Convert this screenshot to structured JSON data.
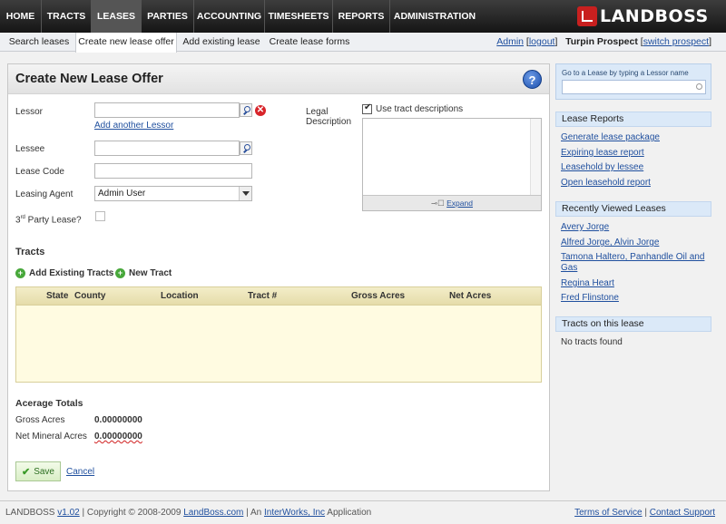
{
  "nav": {
    "items": [
      "HOME",
      "TRACTS",
      "LEASES",
      "PARTIES",
      "ACCOUNTING",
      "TIMESHEETS",
      "REPORTS",
      "ADMINISTRATION"
    ],
    "active_index": 2,
    "logo": "LANDBOSS"
  },
  "subnav": {
    "items": [
      "Search leases",
      "Create new lease offer",
      "Add existing lease",
      "Create lease forms"
    ],
    "active_index": 1,
    "user": "Admin",
    "logout": "logout",
    "project": "Turpin Prospect",
    "switch": "switch prospect"
  },
  "form": {
    "title": "Create New Lease Offer",
    "help": "?",
    "lessor_label": "Lessor",
    "lessor_value": "",
    "add_lessor": "Add another Lessor",
    "lessee_label": "Lessee",
    "lessee_value": "",
    "lease_code_label": "Lease Code",
    "lease_code_value": "",
    "agent_label": "Leasing Agent",
    "agent_value": "Admin User",
    "third_party_label": "3",
    "third_party_sup": "rd",
    "third_party_rest": " Party Lease?",
    "third_party_checked": false,
    "legal_label_1": "Legal",
    "legal_label_2": "Description",
    "use_tract_label": "Use tract descriptions",
    "use_tract_checked": true,
    "expand_label": "Expand",
    "expand_icon": "⊸☐",
    "tracts_title": "Tracts",
    "add_existing": "Add Existing Tracts",
    "new_tract": "New Tract",
    "table_headers": [
      "State",
      "County",
      "Location",
      "Tract #",
      "Gross Acres",
      "Net Acres"
    ],
    "totals_title": "Acerage Totals",
    "gross_label": "Gross Acres",
    "gross_value": "0.00000000",
    "net_label": "Net Mineral Acres",
    "net_value": "0.00000000",
    "save": "Save",
    "cancel": "Cancel"
  },
  "sidebar": {
    "goto_label": "Go to a Lease by typing a Lessor name",
    "goto_value": "",
    "reports_title": "Lease Reports",
    "reports": [
      "Generate lease package",
      "Expiring lease report",
      "Leasehold by lessee",
      "Open leasehold report"
    ],
    "recent_title": "Recently Viewed Leases",
    "recent": [
      "Avery Jorge",
      "Alfred Jorge, Alvin Jorge",
      "Tamona Haltero, Panhandle Oil and",
      "Gas",
      "Regina Heart",
      "Fred Flinstone"
    ],
    "tracts_title": "Tracts on this lease",
    "tracts_empty": "No tracts found"
  },
  "footer": {
    "brand": "LANDBOSS",
    "version": "v1.02",
    "copyright": " | Copyright © 2008-2009 ",
    "site": "LandBoss.com",
    "an": " | An ",
    "company": "InterWorks, Inc",
    "app": " Application",
    "terms": "Terms of Service",
    "sep": " | ",
    "support": "Contact Support"
  }
}
